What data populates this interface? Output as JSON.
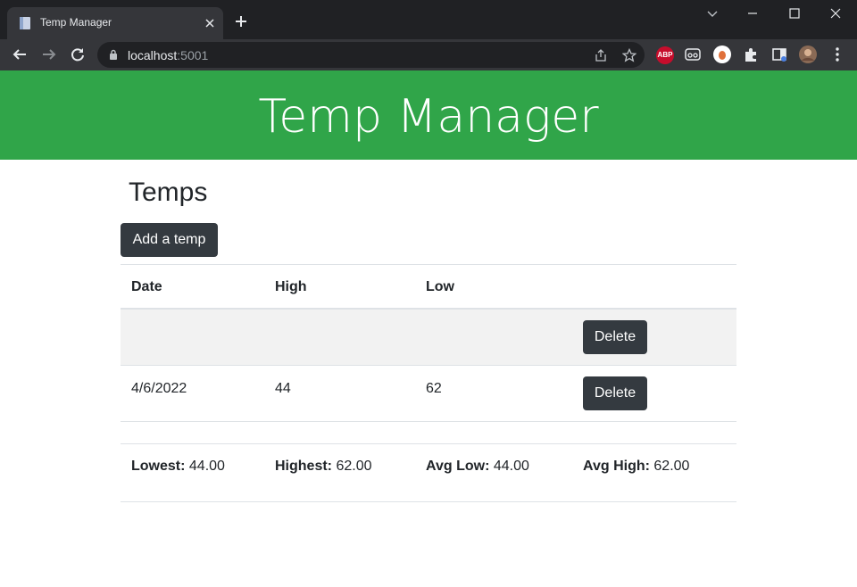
{
  "browser": {
    "tab_title": "Temp Manager",
    "url_host": "localhost",
    "url_port": ":5001",
    "extensions": [
      {
        "name": "adblock-plus-icon",
        "label": "ABP"
      }
    ]
  },
  "banner": {
    "title": "Temp Manager",
    "color": "#30a549"
  },
  "main": {
    "heading": "Temps",
    "add_button_label": "Add a temp",
    "table": {
      "headers": [
        "Date",
        "High",
        "Low",
        ""
      ],
      "rows": [
        {
          "date": "",
          "high": "",
          "low": "",
          "action": "Delete"
        },
        {
          "date": "4/6/2022",
          "high": "44",
          "low": "62",
          "action": "Delete"
        }
      ]
    },
    "summary": {
      "lowest_label": "Lowest:",
      "lowest_value": "44.00",
      "highest_label": "Highest:",
      "highest_value": "62.00",
      "avg_low_label": "Avg Low:",
      "avg_low_value": "44.00",
      "avg_high_label": "Avg High:",
      "avg_high_value": "62.00"
    }
  }
}
